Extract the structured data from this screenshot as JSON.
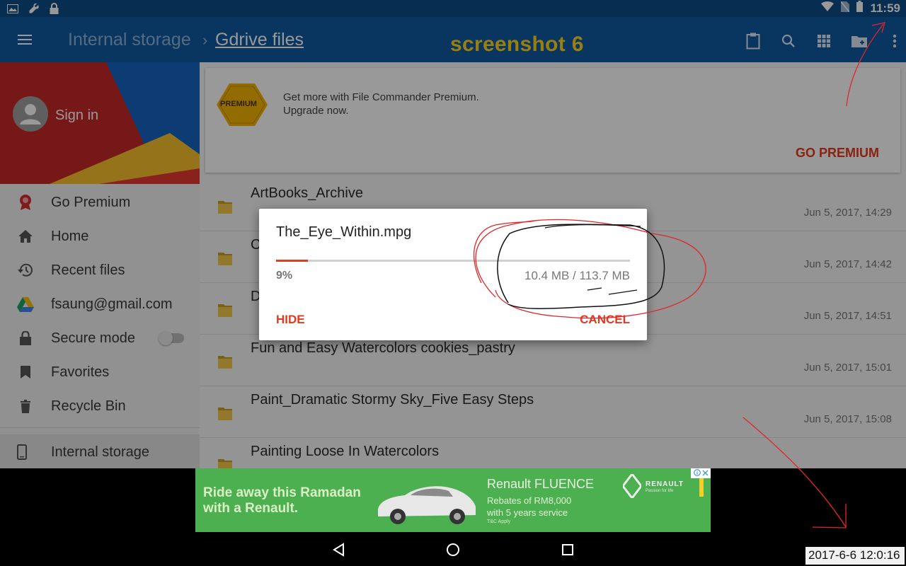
{
  "status_bar": {
    "time": "11:59",
    "left_icons": [
      "image-icon",
      "wrench-icon",
      "lock-icon"
    ],
    "right_icons": [
      "wifi-icon",
      "no-sim-icon",
      "battery-icon"
    ]
  },
  "toolbar": {
    "breadcrumb_parent": "Internal storage",
    "breadcrumb_separator": "›",
    "breadcrumb_current": "Gdrive files",
    "annotation_label": "screenshot 6",
    "icons": [
      "clipboard-icon",
      "search-icon",
      "grid-view-icon",
      "new-folder-icon",
      "more-vert-icon"
    ]
  },
  "drawer": {
    "sign_in": "Sign in",
    "items": [
      {
        "label": "Go Premium",
        "icon": "premium-badge-icon"
      },
      {
        "label": "Home",
        "icon": "home-icon"
      },
      {
        "label": "Recent files",
        "icon": "history-icon"
      },
      {
        "label": "fsaung@gmail.com",
        "icon": "google-drive-icon"
      },
      {
        "label": "Secure mode",
        "icon": "lock-icon",
        "toggle": "off"
      },
      {
        "label": "Favorites",
        "icon": "bookmark-icon"
      },
      {
        "label": "Recycle Bin",
        "icon": "trash-icon"
      }
    ],
    "selected_storage": "Internal storage"
  },
  "promo": {
    "badge": "PREMIUM",
    "line1": "Get more with File Commander Premium.",
    "line2": "Upgrade now.",
    "button": "GO PREMIUM"
  },
  "files": [
    {
      "name": "ArtBooks_Archive",
      "date": "Jun 5, 2017, 14:29"
    },
    {
      "name": "C",
      "date": "Jun 5, 2017, 14:42"
    },
    {
      "name": "D",
      "date": "Jun 5, 2017, 14:51"
    },
    {
      "name": "Fun and Easy Watercolors cookies_pastry",
      "date": "Jun 5, 2017, 15:01"
    },
    {
      "name": "Paint_Dramatic Stormy Sky_Five Easy Steps",
      "date": "Jun 5, 2017, 15:08"
    },
    {
      "name": "Painting Loose In Watercolors",
      "date": ""
    }
  ],
  "dialog": {
    "title": "The_Eye_Within.mpg",
    "progress_fraction": 0.09,
    "percent": "9%",
    "size": "10.4 MB / 113.7 MB",
    "hide": "HIDE",
    "cancel": "CANCEL",
    "accent": "#e5391f"
  },
  "ad": {
    "headline": "Ride away this Ramadan with a Renault.",
    "brand": "Renault FLUENCE",
    "offer_line1": "Rebates of RM8,000",
    "offer_line2": "with 5 years service",
    "tc": "T&C Apply",
    "logo": "RENAULT",
    "tagline": "Passion for life"
  },
  "navbar": {
    "buttons": [
      "back-icon",
      "home-circle-icon",
      "recents-icon"
    ]
  },
  "timestamp": "2017-6-6 12:0:16",
  "colors": {
    "toolbar": "#0e5aa0",
    "status_bar": "#0c4b86",
    "accent": "#e5391f",
    "annotation": "#ffd21f"
  }
}
